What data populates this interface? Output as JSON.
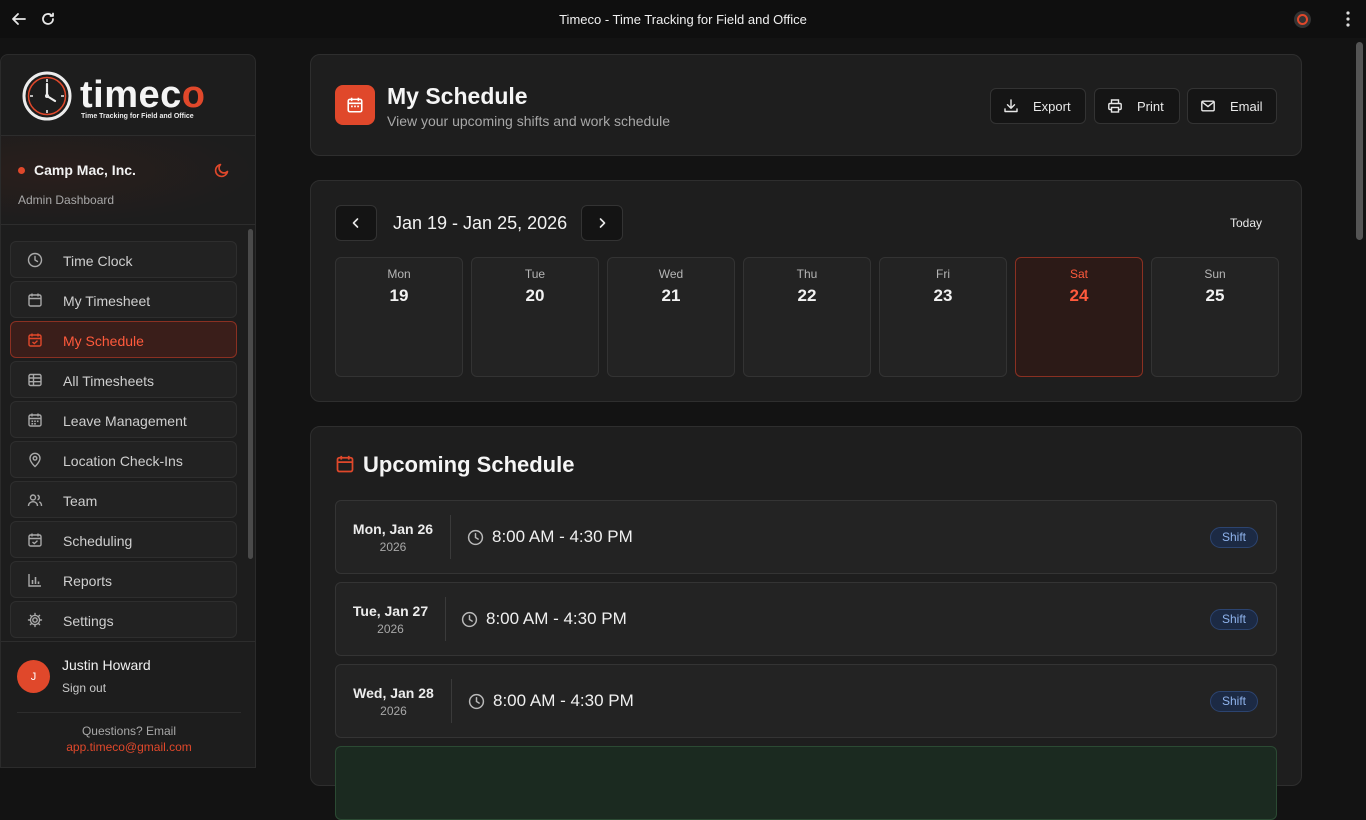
{
  "browser": {
    "title": "Timeco - Time Tracking for Field and Office"
  },
  "logo": {
    "text_a": "time",
    "text_b": "c",
    "text_c": "o",
    "tagline": "Time Tracking for Field and Office"
  },
  "org": {
    "name": "Camp Mac, Inc.",
    "role": "Admin Dashboard"
  },
  "nav": [
    {
      "label": "Time Clock",
      "icon": "clock-icon",
      "active": false
    },
    {
      "label": "My Timesheet",
      "icon": "calendar-icon",
      "active": false
    },
    {
      "label": "My Schedule",
      "icon": "calendar-check-icon",
      "active": true
    },
    {
      "label": "All Timesheets",
      "icon": "table-icon",
      "active": false
    },
    {
      "label": "Leave Management",
      "icon": "calendar-grid-icon",
      "active": false
    },
    {
      "label": "Location Check-Ins",
      "icon": "map-pin-icon",
      "active": false
    },
    {
      "label": "Team",
      "icon": "users-icon",
      "active": false
    },
    {
      "label": "Scheduling",
      "icon": "calendar-check-icon",
      "active": false
    },
    {
      "label": "Reports",
      "icon": "bar-chart-icon",
      "active": false
    },
    {
      "label": "Settings",
      "icon": "gear-icon",
      "active": false
    }
  ],
  "user": {
    "initial": "J",
    "name": "Justin Howard",
    "signout": "Sign out",
    "help_text": "Questions? Email",
    "help_email": "app.timeco@gmail.com"
  },
  "header": {
    "title": "My Schedule",
    "subtitle": "View your upcoming shifts and work schedule",
    "export_label": "Export",
    "print_label": "Print",
    "email_label": "Email"
  },
  "week": {
    "range": "Jan 19 - Jan 25, 2026",
    "today_label": "Today",
    "days": [
      {
        "name": "Mon",
        "num": "19",
        "selected": false
      },
      {
        "name": "Tue",
        "num": "20",
        "selected": false
      },
      {
        "name": "Wed",
        "num": "21",
        "selected": false
      },
      {
        "name": "Thu",
        "num": "22",
        "selected": false
      },
      {
        "name": "Fri",
        "num": "23",
        "selected": false
      },
      {
        "name": "Sat",
        "num": "24",
        "selected": true
      },
      {
        "name": "Sun",
        "num": "25",
        "selected": false
      }
    ]
  },
  "upcoming": {
    "title": "Upcoming Schedule",
    "shifts": [
      {
        "date": "Mon, Jan 26",
        "year": "2026",
        "time": "8:00 AM - 4:30 PM",
        "badge": "Shift"
      },
      {
        "date": "Tue, Jan 27",
        "year": "2026",
        "time": "8:00 AM - 4:30 PM",
        "badge": "Shift"
      },
      {
        "date": "Wed, Jan 28",
        "year": "2026",
        "time": "8:00 AM - 4:30 PM",
        "badge": "Shift"
      }
    ]
  },
  "colors": {
    "accent": "#e0482b",
    "badge_blue": "#8fb3ec"
  }
}
